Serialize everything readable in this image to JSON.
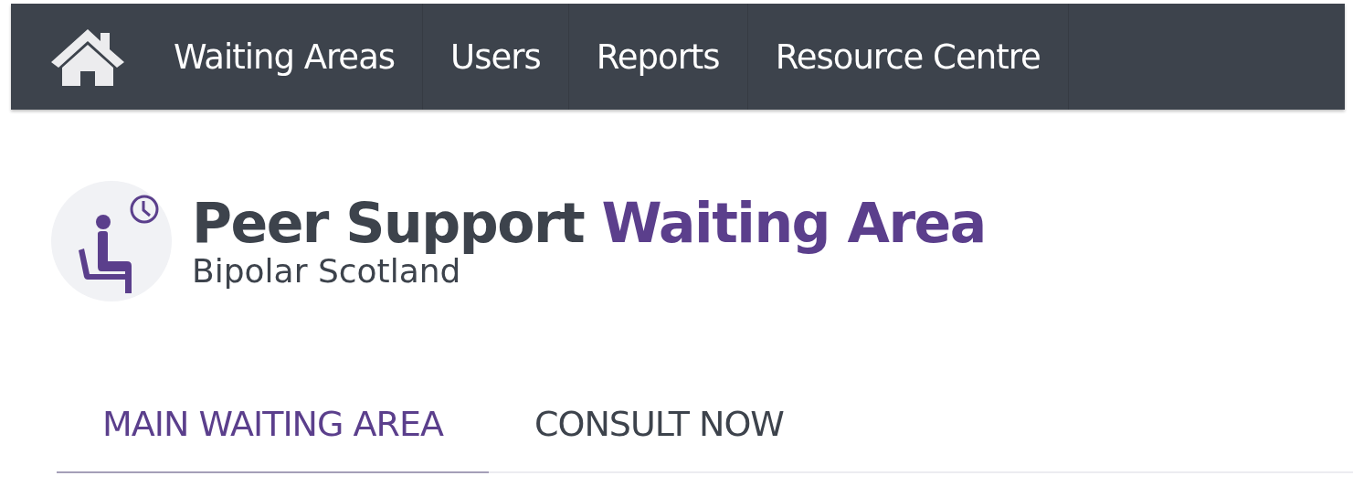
{
  "navbar": {
    "items": [
      {
        "label": "Waiting Areas"
      },
      {
        "label": "Users"
      },
      {
        "label": "Reports"
      },
      {
        "label": "Resource Centre"
      }
    ]
  },
  "header": {
    "title_lead": "Peer Support",
    "title_highlight": "Waiting Area",
    "subtitle": "Bipolar Scotland"
  },
  "tabs": [
    {
      "label": "MAIN WAITING AREA",
      "selected": true
    },
    {
      "label": "CONSULT NOW",
      "selected": false
    }
  ]
}
